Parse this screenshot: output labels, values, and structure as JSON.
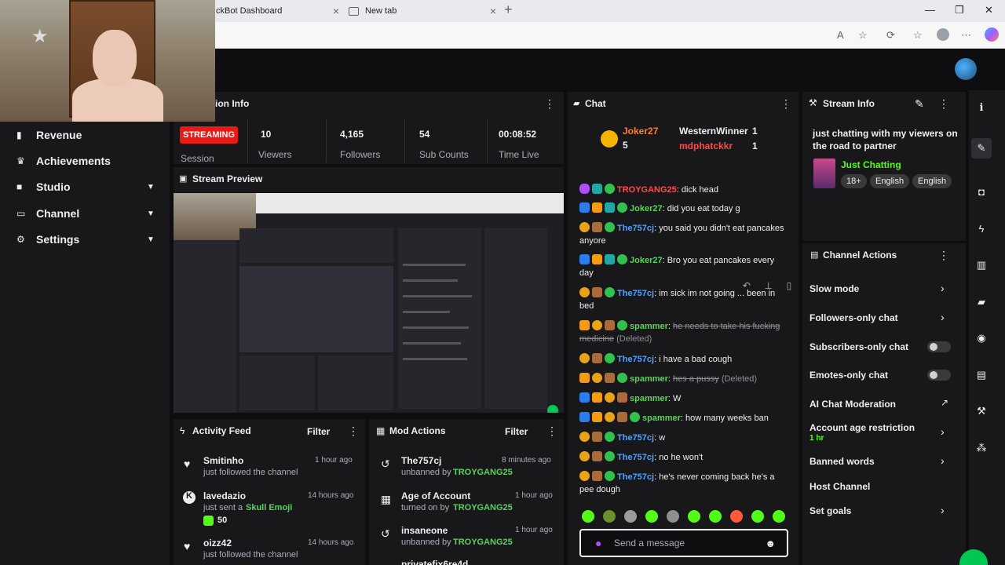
{
  "browser": {
    "tabs": [
      {
        "title": "ckBot Dashboard"
      },
      {
        "title": "New tab"
      }
    ],
    "new_tab": "+",
    "window_controls": [
      "—",
      "❐",
      "✕"
    ]
  },
  "sidebar": {
    "items": [
      {
        "label": "Revenue",
        "icon": "chart-icon"
      },
      {
        "label": "Achievements",
        "icon": "trophy-icon"
      },
      {
        "label": "Studio",
        "icon": "camera-icon"
      },
      {
        "label": "Channel",
        "icon": "tv-icon"
      },
      {
        "label": "Settings",
        "icon": "gear-icon"
      }
    ]
  },
  "session": {
    "title": "ion Info",
    "streaming_label": "STREAMING",
    "session_label": "Session",
    "stats": [
      {
        "value": "10",
        "label": "Viewers"
      },
      {
        "value": "4,165",
        "label": "Followers"
      },
      {
        "value": "54",
        "label": "Sub Counts"
      },
      {
        "value": "00:08:52",
        "label": "Time Live"
      }
    ]
  },
  "preview": {
    "title": "Stream Preview"
  },
  "chat": {
    "title": "Chat",
    "top_users": [
      {
        "name": "Joker27",
        "count": "5"
      },
      {
        "name": "WesternWinner",
        "count": "1"
      },
      {
        "name": "mdphatckkr",
        "count": "1"
      }
    ],
    "messages": [
      {
        "user": "TROYGANG25",
        "text": "dick head",
        "color": "red"
      },
      {
        "user": "Joker27",
        "text": "did you eat today g",
        "color": "green"
      },
      {
        "user": "The757cj",
        "text": "you said you didn't eat pancakes anyore",
        "color": "blue"
      },
      {
        "user": "Joker27",
        "text": "Bro you eat pancakes every day",
        "color": "green"
      },
      {
        "user": "The757cj",
        "text": "im sick im not going ... been in bed",
        "color": "blue"
      },
      {
        "user": "spammer",
        "text": "he needs to take his fucking medicine",
        "deleted": "(Deleted)",
        "color": "green"
      },
      {
        "user": "The757cj",
        "text": "i have a bad cough",
        "color": "blue"
      },
      {
        "user": "spammer",
        "text": "hes a pussy",
        "deleted": "(Deleted)",
        "color": "green"
      },
      {
        "user": "spammer",
        "text": "W",
        "color": "green"
      },
      {
        "user": "spammer",
        "text": "how many weeks ban",
        "color": "green"
      },
      {
        "user": "The757cj",
        "text": "w",
        "color": "blue"
      },
      {
        "user": "The757cj",
        "text": "no he won't",
        "color": "blue"
      },
      {
        "user": "The757cj",
        "text": "he's never coming back he's a pee dough",
        "color": "blue"
      }
    ],
    "input_placeholder": "Send a message"
  },
  "stream_info": {
    "title": "Stream Info",
    "stream_title": "just chatting with my viewers on the road to partner",
    "category": "Just Chatting",
    "tags": [
      "18+",
      "English",
      "English"
    ]
  },
  "channel_actions": {
    "title": "Channel Actions",
    "items": [
      {
        "label": "Slow mode",
        "control": "chevron"
      },
      {
        "label": "Followers-only chat",
        "control": "chevron"
      },
      {
        "label": "Subscribers-only chat",
        "control": "toggle"
      },
      {
        "label": "Emotes-only chat",
        "control": "toggle"
      },
      {
        "label": "AI Chat Moderation",
        "control": "external"
      },
      {
        "label": "Account age restriction",
        "sub": "1 hr",
        "control": "chevron"
      },
      {
        "label": "Banned words",
        "control": "chevron"
      },
      {
        "label": "Host Channel",
        "control": "none"
      },
      {
        "label": "Set goals",
        "control": "chevron"
      }
    ]
  },
  "activity_feed": {
    "title": "Activity Feed",
    "filter_label": "Filter",
    "items": [
      {
        "name": "Smitinho",
        "sub": "just followed the channel",
        "time": "1 hour ago",
        "icon": "heart-icon"
      },
      {
        "name": "lavedazio",
        "sub": "just sent a",
        "highlight": "Skull Emoji",
        "amount": "50",
        "time": "14 hours ago",
        "icon": "kick-icon"
      },
      {
        "name": "oizz42",
        "sub": "just followed the channel",
        "time": "14 hours ago",
        "icon": "heart-icon"
      }
    ]
  },
  "mod_actions": {
    "title": "Mod Actions",
    "filter_label": "Filter",
    "items": [
      {
        "name": "The757cj",
        "sub": "unbanned by",
        "by": "TROYGANG25",
        "time": "8 minutes ago",
        "icon": "undo-icon"
      },
      {
        "name": "Age of Account",
        "sub": "turned on by",
        "by": "TROYGANG25",
        "time": "1 hour ago",
        "icon": "calendar-icon"
      },
      {
        "name": "insaneone",
        "sub": "unbanned by",
        "by": "TROYGANG25",
        "time": "1 hour ago",
        "icon": "undo-icon"
      },
      {
        "name": "privatefix6re4d",
        "sub": "",
        "by": "",
        "time": "",
        "icon": "undo-icon"
      }
    ]
  },
  "colors": {
    "accent": "#53fc18",
    "streaming": "#e91916",
    "bg": "#0e0e10",
    "panel": "#18181b"
  }
}
